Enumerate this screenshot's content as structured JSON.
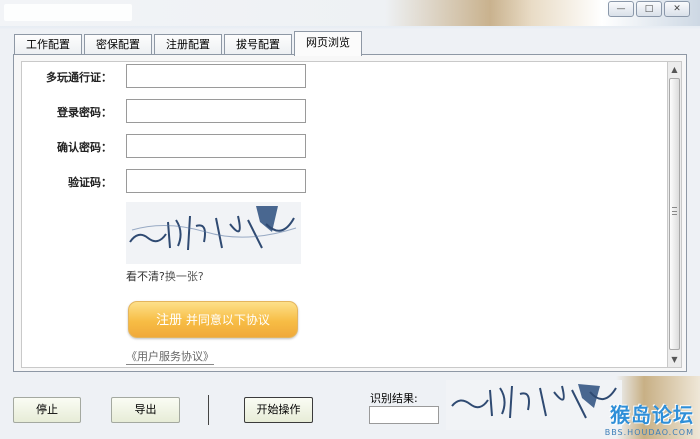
{
  "window": {
    "minimize_label": "—",
    "restore_label": "□",
    "close_label": "✕"
  },
  "tabs": [
    {
      "label": "工作配置"
    },
    {
      "label": "密保配置"
    },
    {
      "label": "注册配置"
    },
    {
      "label": "拔号配置"
    },
    {
      "label": "网页浏览"
    }
  ],
  "form": {
    "account_label": "多玩通行证：",
    "password_label": "登录密码：",
    "confirm_label": "确认密码：",
    "captcha_label": "验证码：",
    "account_value": "",
    "password_value": "",
    "confirm_value": "",
    "captcha_value": "",
    "captcha_image_text": "へ以引体威",
    "refresh_prefix": "看不清?",
    "refresh_link": "换一张?",
    "register_main": "注册",
    "register_sub": "并同意以下协议",
    "agreement_link": "《用户服务协议》"
  },
  "bottom": {
    "stop_label": "停止",
    "export_label": "导出",
    "start_label": "开始操作",
    "result_label": "识别结果:",
    "result_value": ""
  },
  "watermark": {
    "main": "猴岛论坛",
    "sub": "BBS.HOUDAO.COM"
  },
  "colors": {
    "register_button": "#f7bd45",
    "watermark": "#2f8fd8"
  }
}
